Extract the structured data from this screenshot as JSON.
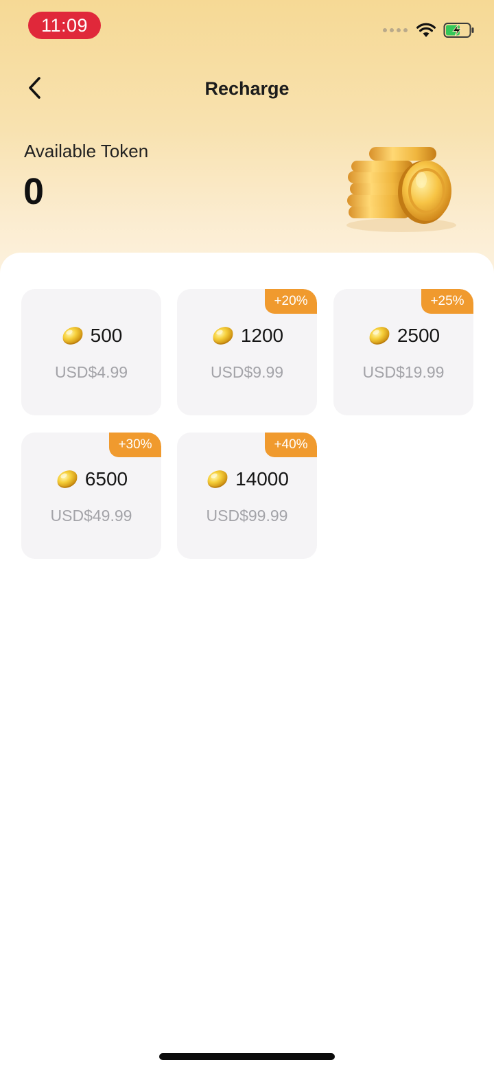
{
  "status_bar": {
    "time": "11:09",
    "time_pill_color": "#e0283a",
    "icons": [
      "signal-dots-icon",
      "wifi-icon",
      "battery-charging-icon"
    ]
  },
  "nav": {
    "back_icon": "chevron-left-icon",
    "title": "Recharge"
  },
  "token": {
    "label": "Available Token",
    "value": "0",
    "illustration": "coin-stack-icon"
  },
  "packages": [
    {
      "amount": "500",
      "price": "USD$4.99",
      "bonus": ""
    },
    {
      "amount": "1200",
      "price": "USD$9.99",
      "bonus": "+20%"
    },
    {
      "amount": "2500",
      "price": "USD$19.99",
      "bonus": "+25%"
    },
    {
      "amount": "6500",
      "price": "USD$49.99",
      "bonus": "+30%"
    },
    {
      "amount": "14000",
      "price": "USD$99.99",
      "bonus": "+40%"
    }
  ],
  "colors": {
    "accent_badge": "#f09a2e",
    "card_bg": "#f5f4f6",
    "price_text": "#a3a3a8",
    "header_gradient_top": "#f6d995",
    "header_gradient_bottom": "#fdf3e2"
  }
}
